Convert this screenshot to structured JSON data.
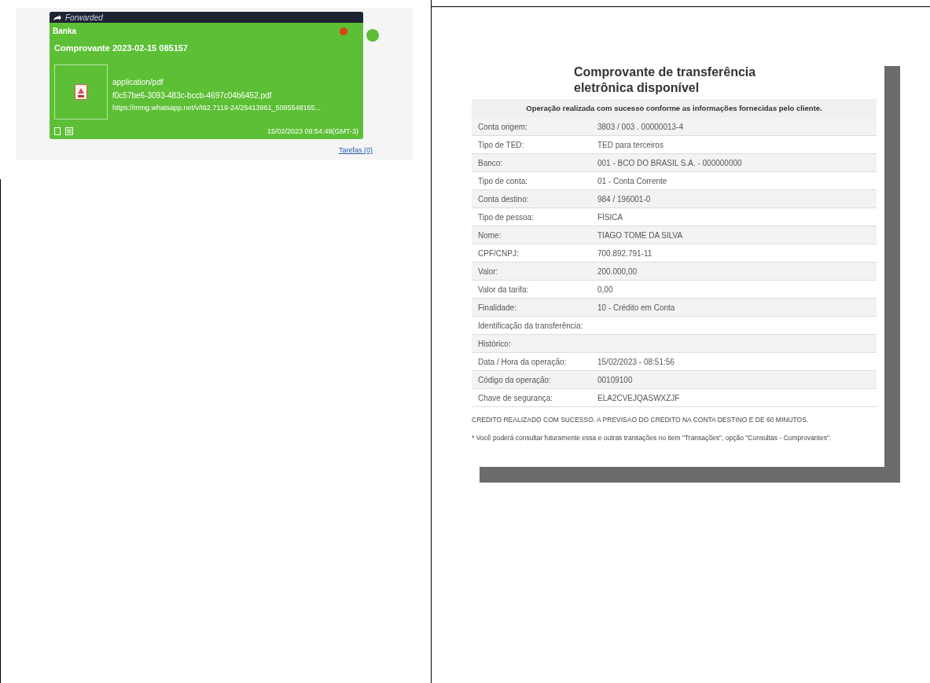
{
  "message": {
    "forwarded_label": "Forwarded",
    "sender": "Banka",
    "caption": "Comprovante 2023-02-15 085157",
    "file": {
      "mime_type": "application/pdf",
      "file_name": "f0c57be6-3093-483c-bccb-4697c04b6452.pdf",
      "url": "https://mmg.whatsapp.net/v/t62.7119-24/25413961_5085548165..."
    },
    "timestamp": "15/02/2023 09:54:49(GMT-3)",
    "tasks_link": "Tarefas (0)"
  },
  "receipt": {
    "title": "Comprovante de transferência eletrônica disponível",
    "notice": "Operação realizada com sucesso conforme as informações fornecidas pelo cliente.",
    "rows": [
      {
        "label": "Conta origem:",
        "value": "3803 / 003 . 00000013-4"
      },
      {
        "label": "Tipo de TED:",
        "value": "TED para terceiros"
      },
      {
        "label": "Banco:",
        "value": "001 - BCO DO BRASIL S.A. - 000000000"
      },
      {
        "label": "Tipo de conta:",
        "value": "01 - Conta Corrente"
      },
      {
        "label": "Conta destino:",
        "value": "984 / 196001-0"
      },
      {
        "label": "Tipo de pessoa:",
        "value": "FÍSICA"
      },
      {
        "label": "Nome:",
        "value": "TIAGO TOME DA SILVA"
      },
      {
        "label": "CPF/CNPJ:",
        "value": "700.892.791-11"
      },
      {
        "label": "Valor:",
        "value": "200.000,00"
      },
      {
        "label": "Valor da tarifa:",
        "value": "0,00"
      },
      {
        "label": "Finalidade:",
        "value": "10 - Crédito em Conta"
      },
      {
        "label": "Identificação da transferência:"
      },
      {
        "label": "Histórico:"
      },
      {
        "label": "Data / Hora da operação:",
        "value": "15/02/2023 - 08:51:56"
      },
      {
        "label": "Código da operação:",
        "value": "00109100"
      },
      {
        "label": "Chave de segurança:",
        "value": "ELA2CVEJQASWXZJF"
      }
    ],
    "footer_notes": [
      "CREDITO REALIZADO COM SUCESSO. A PREVISAO DO CREDITO NA CONTA DESTINO E DE 60 MINUTOS.",
      "* Você poderá consultar futuramente essa e outras transações no item \"Transações\", opção \"Consultas - Comprovantes\"."
    ]
  }
}
